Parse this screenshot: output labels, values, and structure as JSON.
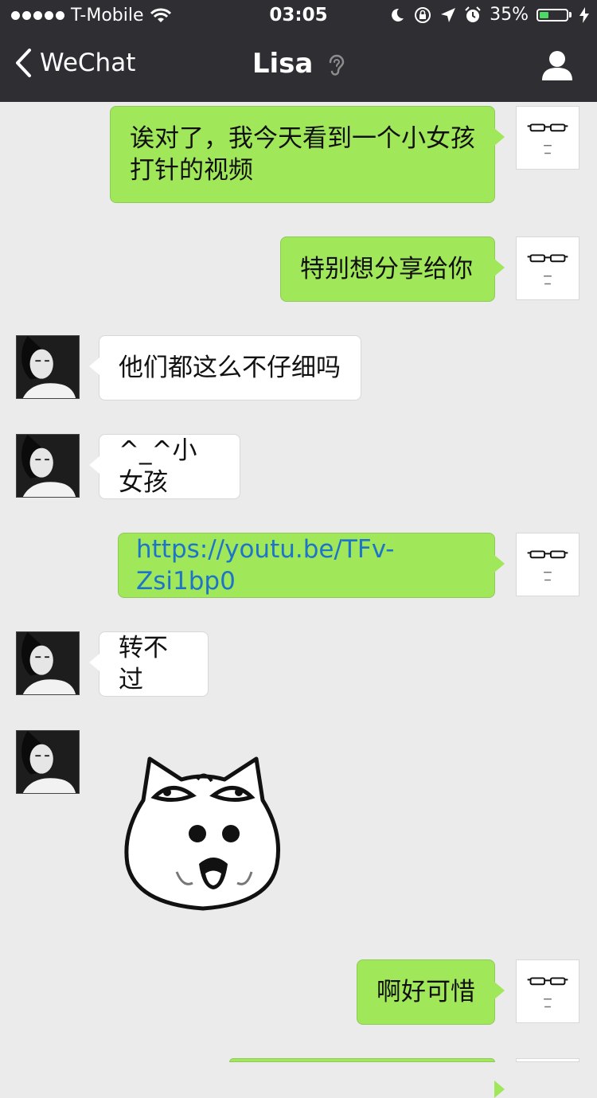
{
  "status_bar": {
    "carrier": "T-Mobile",
    "time": "03:05",
    "battery": "35%",
    "battery_level": 0.35
  },
  "nav": {
    "back_label": "WeChat",
    "title": "Lisa"
  },
  "messages": [
    {
      "sender": "me",
      "text": "诶对了，我今天看到一个小女孩打针的视频"
    },
    {
      "sender": "me",
      "text": "特别想分享给你"
    },
    {
      "sender": "lisa",
      "text": "他们都这么不仔细吗"
    },
    {
      "sender": "lisa",
      "text": "^_^小女孩"
    },
    {
      "sender": "me",
      "text": "https://youtu.be/TFv-Zsi1bp0"
    },
    {
      "sender": "lisa",
      "text": "转不过"
    },
    {
      "sender": "lisa",
      "sticker": "cat-face-sticker"
    },
    {
      "sender": "me",
      "text": "啊好可惜"
    }
  ],
  "colors": {
    "nav_background": "#2e2e33",
    "chat_background": "#ebebeb",
    "outgoing_bubble": "#a0e75a",
    "incoming_bubble": "#ffffff",
    "link": "#1d74c9",
    "battery_fill": "#4cd964"
  }
}
